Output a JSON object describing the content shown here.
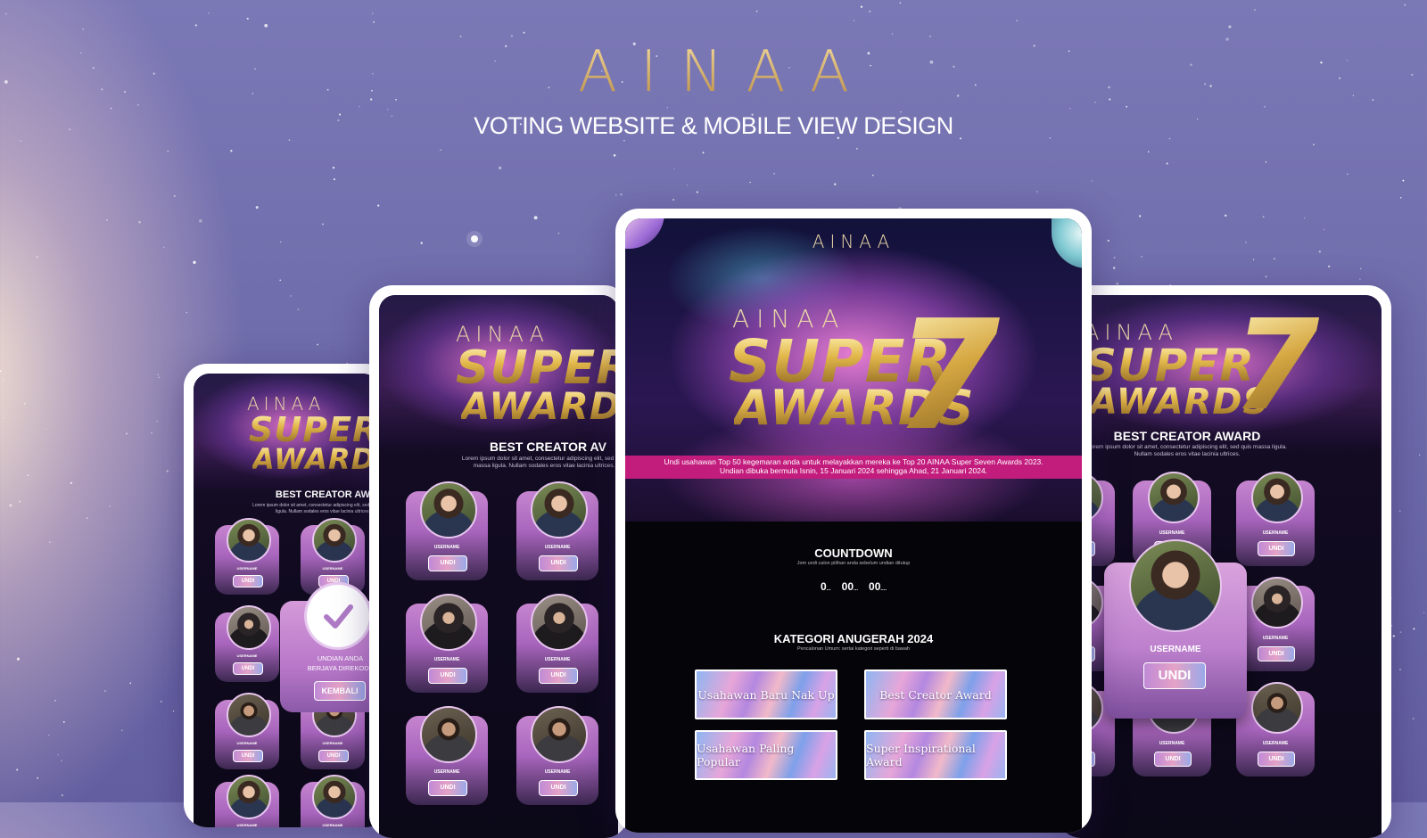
{
  "brand": {
    "logo": "AINAA",
    "subtitle": "VOTING WEBSITE  & MOBILE VIEW DESIGN"
  },
  "hero": {
    "logo_small": "AINAA",
    "line1": "SUPER",
    "line2": "AWARDS",
    "numeral": "7"
  },
  "award": {
    "title": "BEST CREATOR AWARD",
    "title_short": "BEST CREATOR AW",
    "title_mid": "BEST CREATOR AV",
    "lorem": "Lorem ipsum dolor sit amet, consectetur adipiscing elit, sed quis massa ligula. Nullam sodales eros vitae lacinia ultrices."
  },
  "candidates": {
    "username": "USERNAME",
    "vote_label": "UNDI"
  },
  "confirm": {
    "message1": "UNDIAN ANDA",
    "message2": "BERJAYA DIREKODKAN !",
    "back_label": "KEMBALI"
  },
  "banner": {
    "line1": "Undi usahawan Top 50 kegemaran anda untuk melayakkan mereka ke Top 20 AINAA Super Seven Awards 2023.",
    "line2": "Undian dibuka bermula Isnin, 15 Januari 2024 sehingga Ahad, 21 Januari 2024."
  },
  "countdown": {
    "title": "COUNTDOWN",
    "subtitle": "Jom undi calon pilihan anda sebelum undian ditutup",
    "days": "0",
    "hours": "00",
    "minutes": "00"
  },
  "categories": {
    "title": "KATEGORI ANUGERAH 2024",
    "subtitle": "Pencalonan Umum: sertai kategori seperti di bawah",
    "items": [
      "Usahawan Baru Nak Up",
      "Best Creator Award",
      "Usahawan Paling Popular",
      "Super Inspirational Award"
    ]
  },
  "colors": {
    "background": "#6f6cab",
    "gold": "#d9b04a",
    "banner": "#c2187a",
    "card": "#b874c8"
  }
}
